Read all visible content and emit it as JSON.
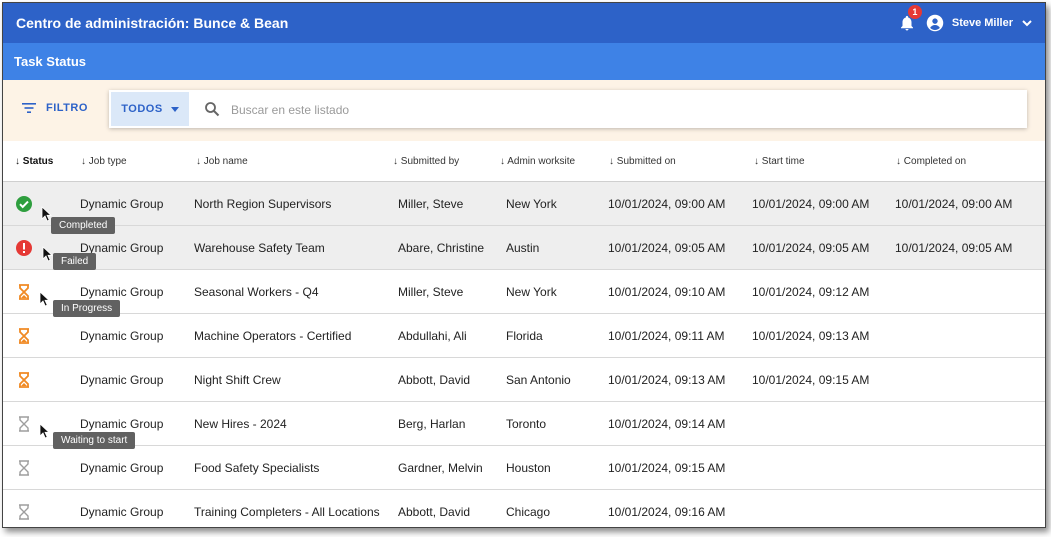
{
  "header": {
    "title": "Centro de administración: Bunce & Bean",
    "notification_count": "1",
    "user_name": "Steve Miller"
  },
  "subheader": {
    "title": "Task Status"
  },
  "filter": {
    "filter_label": "FILTRO",
    "scope_label": "TODOS",
    "search_placeholder": "Buscar en este listado"
  },
  "columns": [
    "Status",
    "Job type",
    "Job name",
    "Submitted by",
    "Admin worksite",
    "Submitted on",
    "Start time",
    "Completed on"
  ],
  "rows": [
    {
      "status": "completed",
      "job_type": "Dynamic Group",
      "job_name": "North Region Supervisors",
      "submitted_by": "Miller, Steve",
      "worksite": "New York",
      "submitted_on": "10/01/2024, 09:00 AM",
      "start_time": "10/01/2024, 09:00 AM",
      "completed_on": "10/01/2024, 09:00 AM",
      "tooltip": "Completed"
    },
    {
      "status": "failed",
      "job_type": "Dynamic Group",
      "job_name": "Warehouse Safety Team",
      "submitted_by": "Abare, Christine",
      "worksite": "Austin",
      "submitted_on": "10/01/2024, 09:05 AM",
      "start_time": "10/01/2024, 09:05 AM",
      "completed_on": "10/01/2024, 09:05 AM",
      "tooltip": "Failed"
    },
    {
      "status": "in-progress",
      "job_type": "Dynamic Group",
      "job_name": "Seasonal Workers - Q4",
      "submitted_by": "Miller, Steve",
      "worksite": "New York",
      "submitted_on": "10/01/2024, 09:10 AM",
      "start_time": "10/01/2024, 09:12 AM",
      "completed_on": "",
      "tooltip": "In Progress"
    },
    {
      "status": "in-progress",
      "job_type": "Dynamic Group",
      "job_name": "Machine Operators - Certified",
      "submitted_by": "Abdullahi, Ali",
      "worksite": "Florida",
      "submitted_on": "10/01/2024, 09:11 AM",
      "start_time": "10/01/2024, 09:13 AM",
      "completed_on": "",
      "tooltip": ""
    },
    {
      "status": "in-progress",
      "job_type": "Dynamic Group",
      "job_name": "Night Shift Crew",
      "submitted_by": "Abbott, David",
      "worksite": "San Antonio",
      "submitted_on": "10/01/2024, 09:13 AM",
      "start_time": "10/01/2024, 09:15 AM",
      "completed_on": "",
      "tooltip": ""
    },
    {
      "status": "waiting",
      "job_type": "Dynamic Group",
      "job_name": "New Hires - 2024",
      "submitted_by": "Berg, Harlan",
      "worksite": "Toronto",
      "submitted_on": "10/01/2024, 09:14 AM",
      "start_time": "",
      "completed_on": "",
      "tooltip": "Waiting to start"
    },
    {
      "status": "waiting",
      "job_type": "Dynamic Group",
      "job_name": "Food Safety Specialists",
      "submitted_by": "Gardner, Melvin",
      "worksite": "Houston",
      "submitted_on": "10/01/2024, 09:15 AM",
      "start_time": "",
      "completed_on": "",
      "tooltip": ""
    },
    {
      "status": "waiting",
      "job_type": "Dynamic Group",
      "job_name": "Training Completers - All Locations",
      "submitted_by": "Abbott, David",
      "worksite": "Chicago",
      "submitted_on": "10/01/2024, 09:16 AM",
      "start_time": "",
      "completed_on": "",
      "tooltip": ""
    }
  ],
  "colors": {
    "header_bg": "#2d62c8",
    "subheader_bg": "#3e82e6",
    "filter_bg": "#fdf3e6",
    "completed": "#2e9e3e",
    "failed": "#e53935",
    "in_progress": "#f08a24",
    "waiting": "#9e9e9e"
  },
  "icons": {
    "filter": "filter-lines-icon",
    "search": "search-icon",
    "bell": "bell-icon",
    "avatar": "account-circle-icon",
    "chevron": "chevron-down-icon"
  }
}
